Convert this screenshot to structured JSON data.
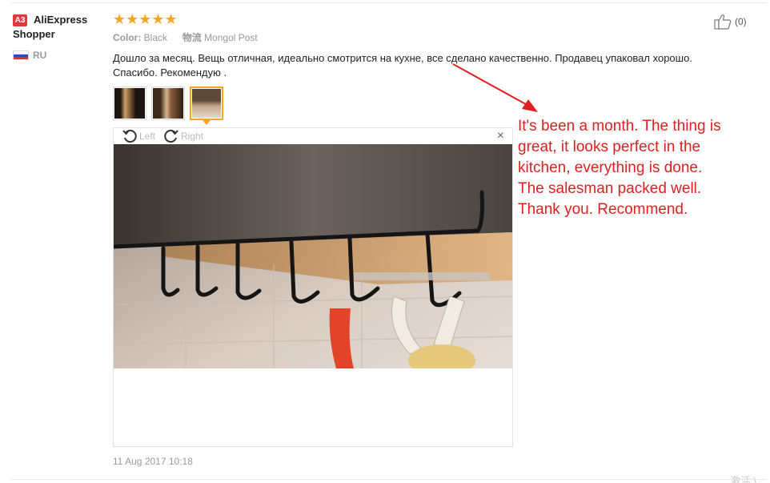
{
  "reviewer": {
    "badge": "A3",
    "name": "AliExpress Shopper",
    "country": "RU"
  },
  "rating": {
    "stars": 5,
    "stars_text": "★★★★★"
  },
  "attributes": {
    "color_label": "Color:",
    "color_value": "Black",
    "logistics_label": "物流",
    "logistics_value": "Mongol Post"
  },
  "helpful": {
    "count_text": "(0)"
  },
  "review": {
    "text": "Дошло за месяц. Вещь отличная, идеально смотрится на кухне, все сделано качественно. Продавец упаковал хорошо. Спасибо. Рекомендую ."
  },
  "viewer": {
    "rotate_left_label": "Left",
    "rotate_right_label": "Right",
    "close_symbol": "×"
  },
  "date": "11 Aug 2017 10:18",
  "annotation": {
    "text": "It's been a month. The thing is\n great, it looks perfect in the\nkitchen, everything is done.\nThe salesman packed well.\nThank you. Recommend."
  },
  "watermark": "激活 \\",
  "colors": {
    "star": "#f5a623",
    "annotation": "#e02020",
    "badge": "#e4393c"
  }
}
